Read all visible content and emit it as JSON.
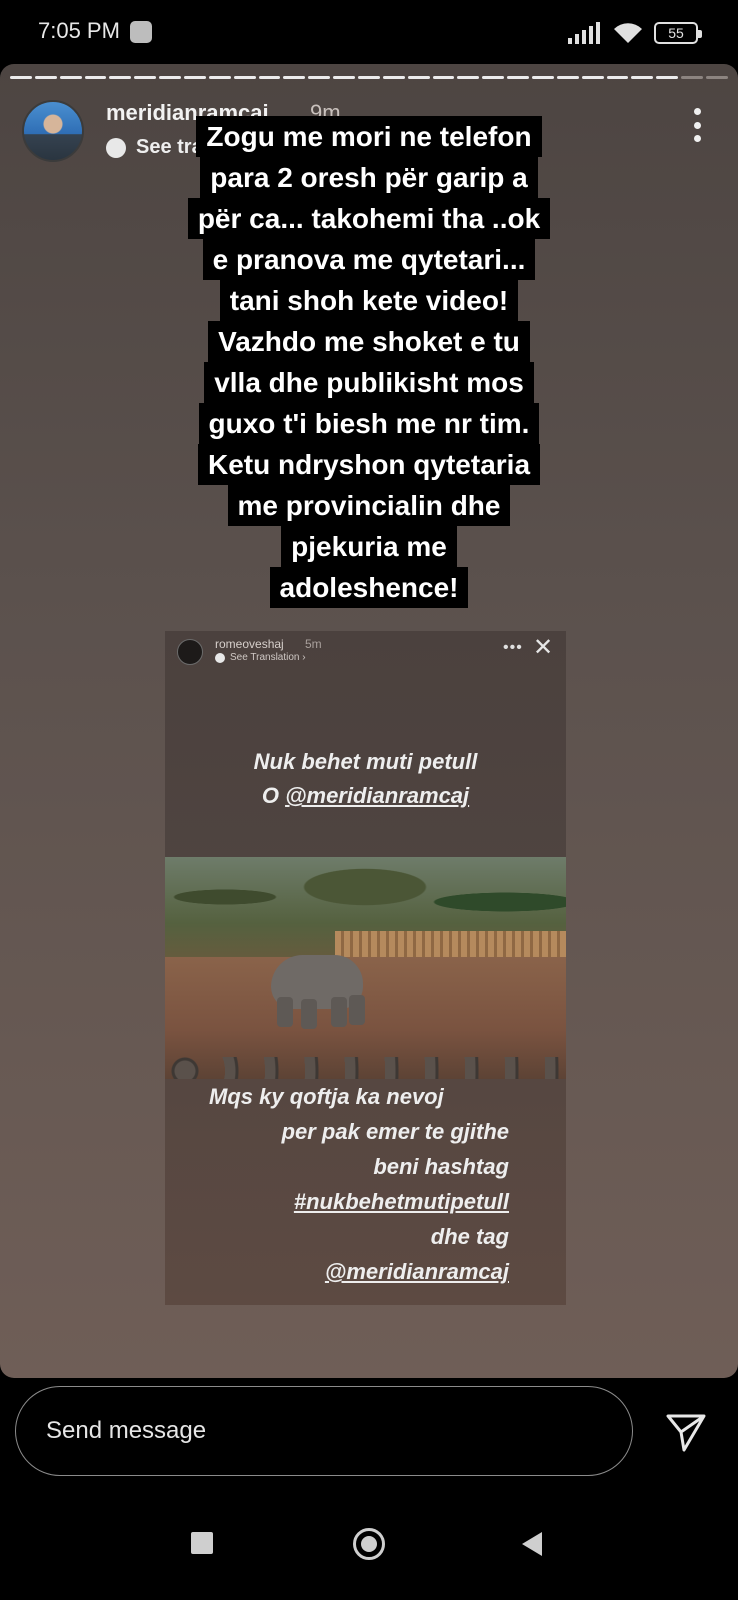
{
  "status_bar": {
    "time": "7:05 PM",
    "battery": "55",
    "icons": [
      "notification-icon",
      "signal-icon",
      "wifi-icon",
      "battery-icon"
    ]
  },
  "story": {
    "progress": {
      "total_segments": 29,
      "viewed_segments": 27
    },
    "username": "meridianramcaj",
    "time_ago": "9m",
    "see_translation": "See translation",
    "caption_lines": [
      "Zogu me mori ne telefon",
      "para 2 oresh për garip a",
      "për ca... takohemi tha ..ok",
      "e pranova me qytetari...",
      "tani shoh kete video!",
      "Vazhdo me shoket e tu",
      "vlla dhe publikisht mos",
      "guxo t'i biesh me nr tim.",
      "Ketu ndryshon qytetaria",
      "me provincialin dhe",
      "pjekuria me",
      "adoleshence!"
    ],
    "embedded": {
      "username": "romeoveshaj",
      "time_ago": "5m",
      "see_translation": "See Translation ›",
      "text_top_line1": "Nuk behet muti petull",
      "text_top_line2_prefix": "O ",
      "text_top_mention": "@meridianramcaj",
      "text_bottom": [
        "Mqs ky qoftja ka nevoj",
        "per pak emer te gjithe",
        "beni hashtag",
        "#nukbehetmutipetull",
        "dhe tag",
        "@meridianramcaj"
      ]
    }
  },
  "message_bar": {
    "placeholder": "Send message"
  },
  "colors": {
    "background": "#000000",
    "story_bg": "#5b514d",
    "text": "#ffffff"
  }
}
